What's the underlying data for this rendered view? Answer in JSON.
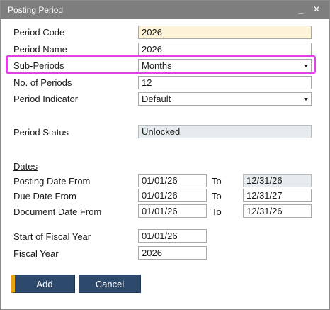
{
  "window": {
    "title": "Posting Period",
    "minimize_glyph": "_",
    "maximize_glyph": "☐",
    "close_glyph": "✕"
  },
  "form": {
    "period_code_label": "Period Code",
    "period_code_value": "2026",
    "period_name_label": "Period Name",
    "period_name_value": "2026",
    "sub_periods_label": "Sub-Periods",
    "sub_periods_value": "Months",
    "num_periods_label": "No. of Periods",
    "num_periods_value": "12",
    "period_indicator_label": "Period Indicator",
    "period_indicator_value": "Default",
    "period_status_label": "Period Status",
    "period_status_value": "Unlocked"
  },
  "dates": {
    "section_label": "Dates",
    "to_label": "To",
    "posting_label": "Posting Date From",
    "posting_from": "01/01/26",
    "posting_to": "12/31/26",
    "due_label": "Due Date From",
    "due_from": "01/01/26",
    "due_to": "12/31/27",
    "document_label": "Document Date From",
    "document_from": "01/01/26",
    "document_to": "12/31/26"
  },
  "fiscal": {
    "start_label": "Start of Fiscal Year",
    "start_value": "01/01/26",
    "year_label": "Fiscal Year",
    "year_value": "2026"
  },
  "buttons": {
    "add_label": "Add",
    "cancel_label": "Cancel"
  },
  "colors": {
    "titlebar": "#7e7e7e",
    "highlight": "#e040e6",
    "button": "#2d4a6d",
    "button_accent": "#e8a317",
    "yellow_field": "#fdf3d8",
    "readonly_field": "#e6ebee"
  }
}
